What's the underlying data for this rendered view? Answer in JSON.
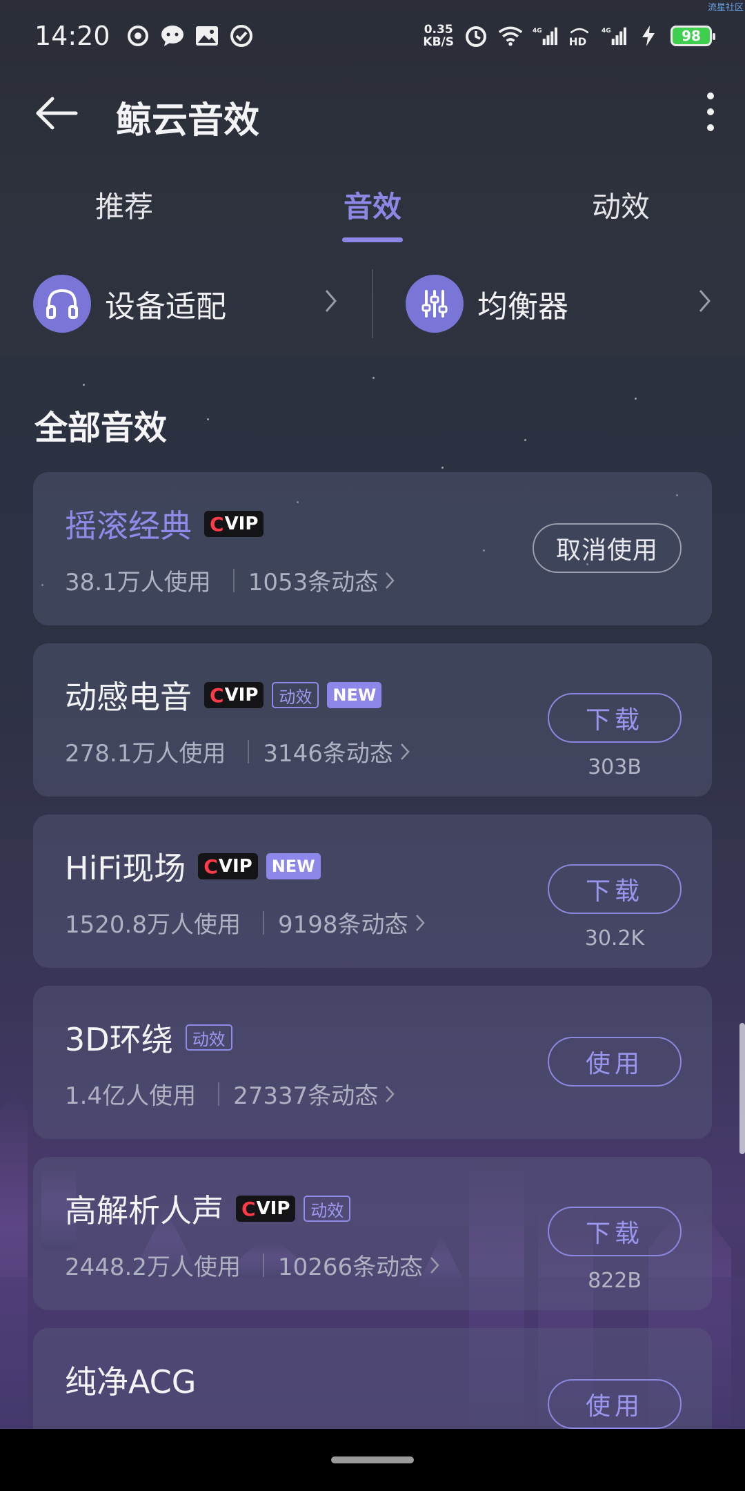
{
  "status_bar": {
    "time": "14:20",
    "net_speed_value": "0.35",
    "net_speed_unit": "KB/S",
    "battery": "98",
    "corner_tag": "流星社区",
    "icons": [
      "weibo-icon",
      "message-icon",
      "gallery-icon",
      "check-circle-icon",
      "alarm-icon",
      "wifi-icon",
      "signal-4g-icon",
      "hd-icon",
      "signal-4g-icon",
      "charging-icon",
      "battery-icon"
    ]
  },
  "app_bar": {
    "title": "鲸云音效"
  },
  "tabs": [
    {
      "label": "推荐"
    },
    {
      "label": "音效"
    },
    {
      "label": "动效"
    }
  ],
  "active_tab": "音效",
  "quick_entries": [
    {
      "label": "设备适配",
      "icon": "headphones-icon"
    },
    {
      "label": "均衡器",
      "icon": "equalizer-icon"
    }
  ],
  "section_title": "全部音效",
  "effects": [
    {
      "name": "摇滚经典",
      "badges": [
        "vip"
      ],
      "users": "38.1万人使用",
      "posts": "1053条动态",
      "button": "取消使用",
      "size": ""
    },
    {
      "name": "动感电音",
      "badges": [
        "vip",
        "动效",
        "NEW"
      ],
      "users": "278.1万人使用",
      "posts": "3146条动态",
      "button": "下载",
      "size": "303B"
    },
    {
      "name": "HiFi现场",
      "badges": [
        "vip",
        "NEW"
      ],
      "users": "1520.8万人使用",
      "posts": "9198条动态",
      "button": "下载",
      "size": "30.2K"
    },
    {
      "name": "3D环绕",
      "badges": [
        "动效"
      ],
      "users": "1.4亿人使用",
      "posts": "27337条动态",
      "button": "使用",
      "size": ""
    },
    {
      "name": "高解析人声",
      "badges": [
        "vip",
        "动效"
      ],
      "users": "2448.2万人使用",
      "posts": "10266条动态",
      "button": "下载",
      "size": "822B"
    },
    {
      "name": "纯净ACG",
      "badges": [],
      "users": "",
      "posts": "",
      "button": "使用",
      "size": ""
    }
  ],
  "badge_text": {
    "vip_c": "C",
    "vip_rest": "VIP",
    "dx": "动效",
    "new": "NEW"
  },
  "colors": {
    "accent": "#8d88e6",
    "vip_red": "#ff3b4a",
    "battery_green": "#3fcf4f"
  }
}
